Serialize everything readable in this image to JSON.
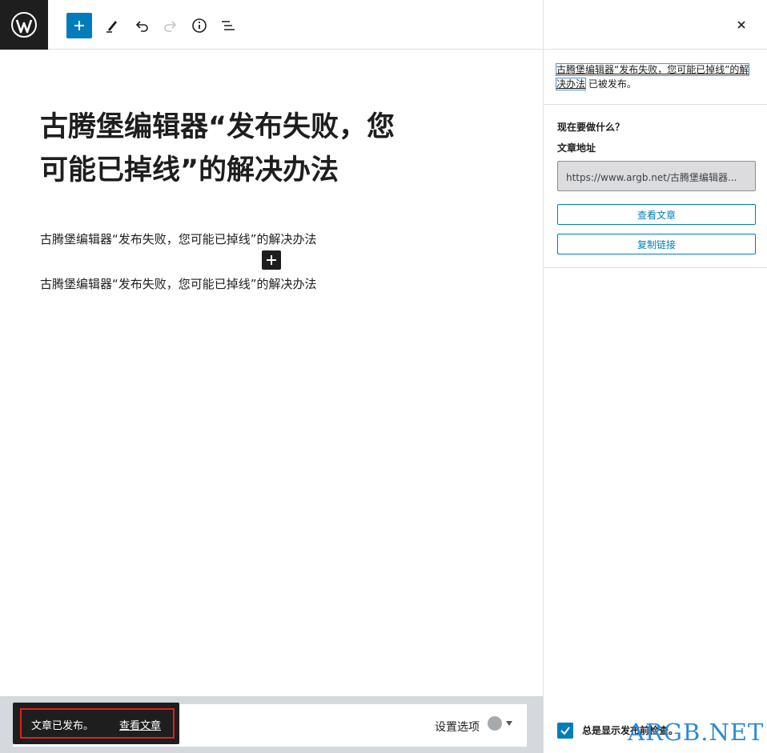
{
  "toolbar": {
    "logo_icon": "wordpress-icon",
    "add_icon": "plus-icon",
    "tools_icon": "pencil-icon",
    "undo_icon": "undo-icon",
    "redo_icon": "redo-icon",
    "info_icon": "info-icon",
    "outline_icon": "list-view-icon"
  },
  "editor": {
    "title": "古腾堡编辑器“发布失败，您可能已掉线”的解决办法",
    "paragraphs": [
      "古腾堡编辑器“发布失败，您可能已掉线”的解决办法",
      "古腾堡编辑器“发布失败，您可能已掉线”的解决办法"
    ]
  },
  "notice": {
    "text": "文章已发布。",
    "link": "查看文章"
  },
  "footer": {
    "settings_label": "设置选项"
  },
  "sidebar": {
    "post_link": "古腾堡编辑器“发布失败，您可能已掉线”的解决办法",
    "published_suffix": "已被发布。",
    "whats_next": "现在要做什么？",
    "url_label": "文章地址",
    "url_value": "https://www.argb.net/古腾堡编辑器...",
    "view_button": "查看文章",
    "copy_button": "复制链接",
    "checkbox_label": "总是显示发布前检查。",
    "checkbox_checked": true
  },
  "watermark": "ARGB.NET",
  "colors": {
    "accent": "#007cba",
    "dark": "#1e1e1e",
    "highlight": "#e02020"
  }
}
